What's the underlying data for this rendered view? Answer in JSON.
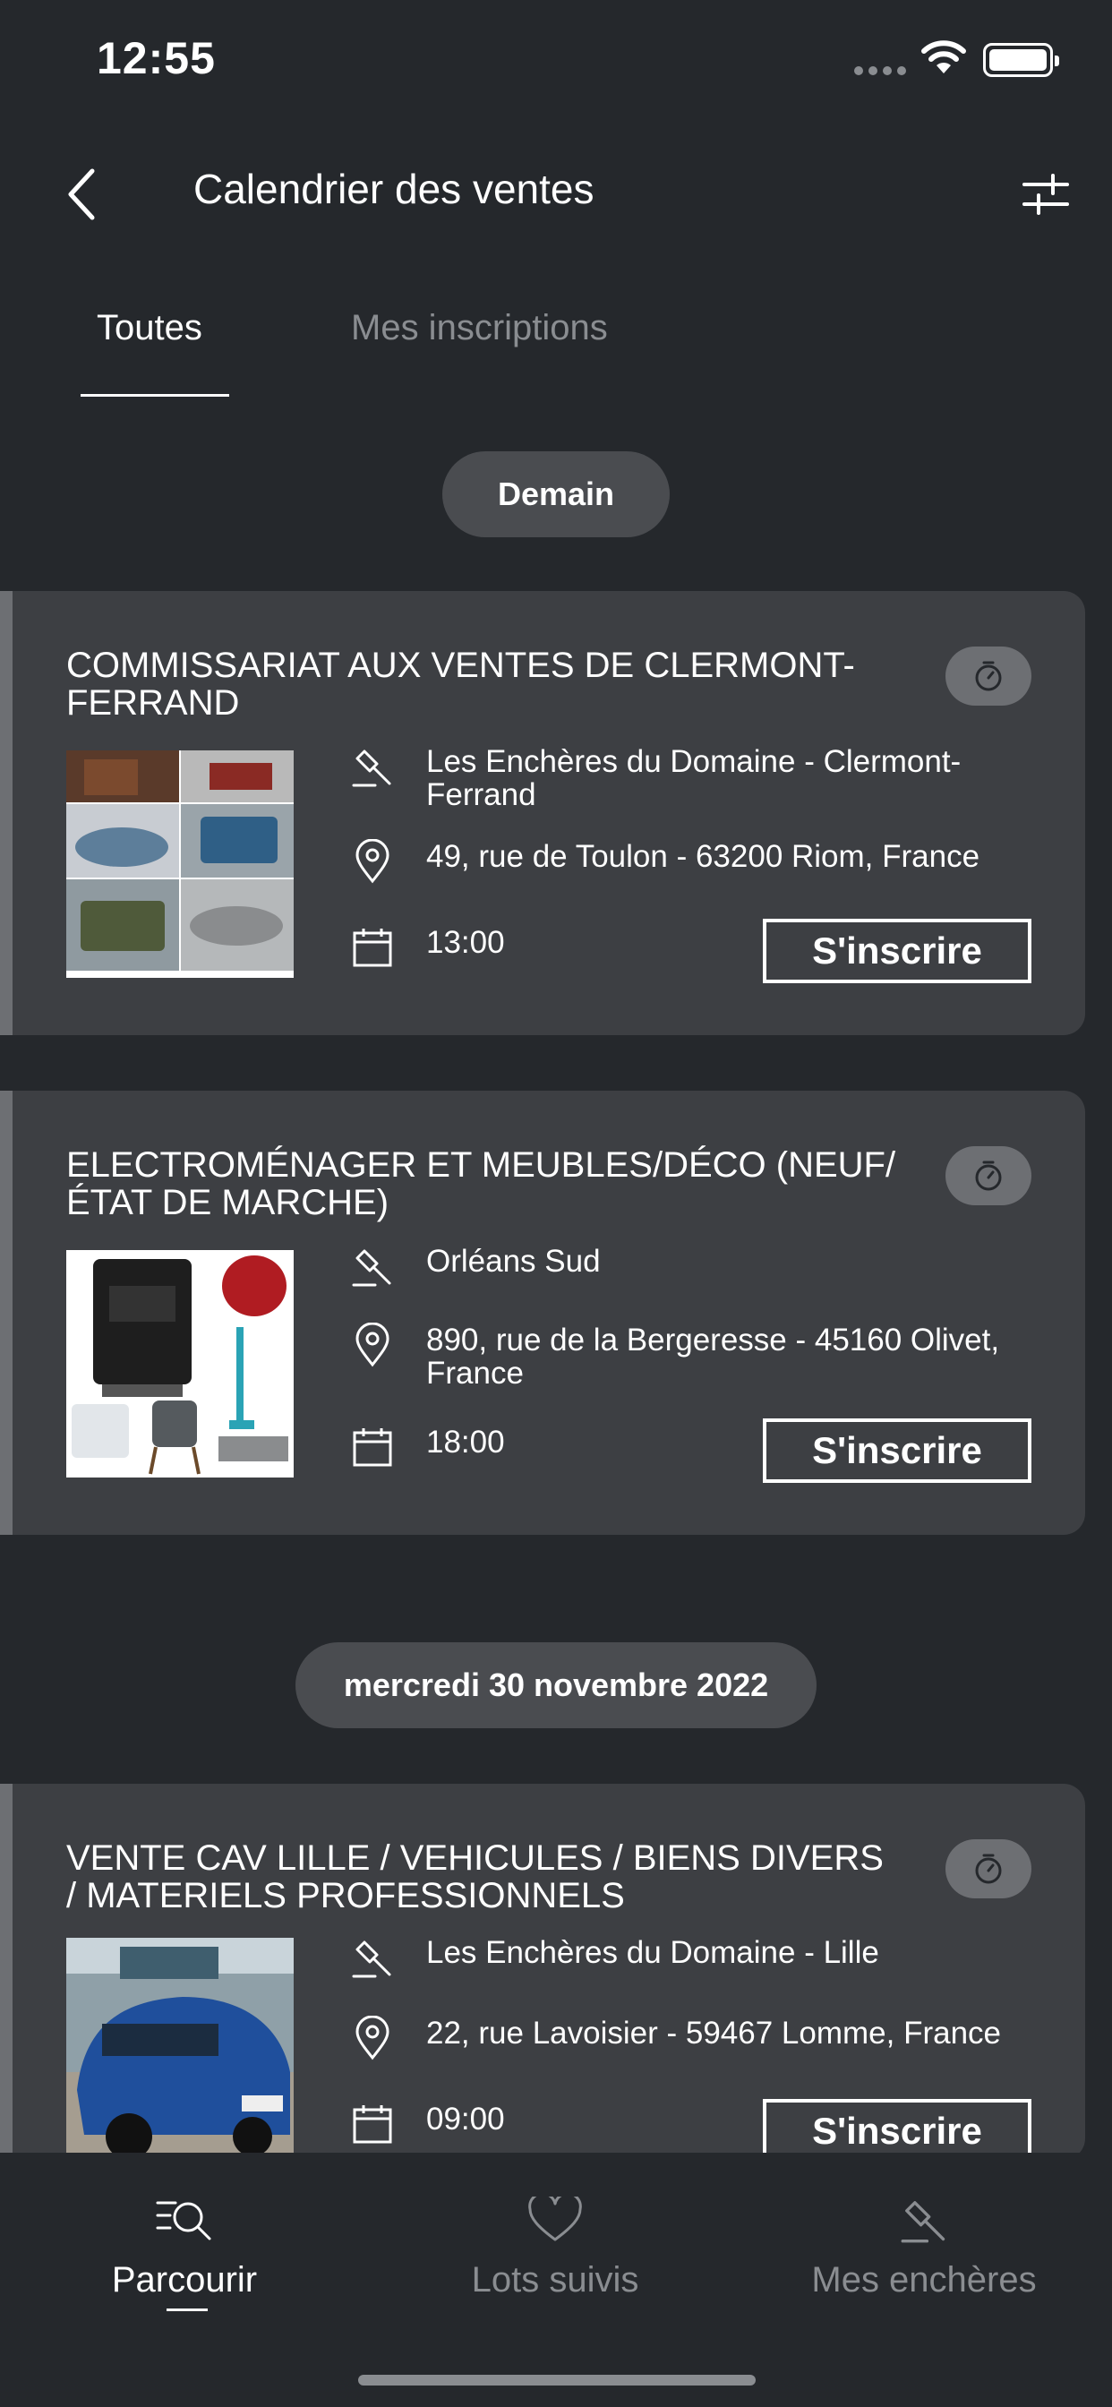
{
  "status": {
    "time": "12:55"
  },
  "header": {
    "title": "Calendrier des ventes"
  },
  "tabs": [
    {
      "label": "Toutes",
      "active": true
    },
    {
      "label": "Mes inscriptions",
      "active": false
    }
  ],
  "groups": [
    {
      "date_label": "Demain"
    },
    {
      "date_label": "mercredi 30 novembre 2022"
    }
  ],
  "sales": [
    {
      "title": "COMMISSARIAT AUX VENTES DE CLERMONT-FERRAND",
      "house": "Les Enchères du Domaine - Clermont-Ferrand",
      "address": "49, rue de Toulon  - 63200 Riom, France",
      "time": "13:00",
      "action": "S'inscrire",
      "image": "vehicles-collage"
    },
    {
      "title": "ELECTROMÉNAGER ET MEUBLES/DÉCO (NEUF/ ÉTAT DE MARCHE)",
      "house": "Orléans Sud",
      "address": "890, rue de la Bergeresse - 45160  Olivet, France",
      "time": "18:00",
      "action": "S'inscrire",
      "image": "appliances-collage"
    },
    {
      "title": "VENTE CAV LILLE / VEHICULES / BIENS DIVERS / MATERIELS PROFESSIONNELS",
      "house": "Les Enchères du Domaine - Lille",
      "address": "22, rue Lavoisier  - 59467 Lomme, France",
      "time": "09:00",
      "action": "S'inscrire",
      "image": "blue-car-photo"
    }
  ],
  "bottom_nav": [
    {
      "label": "Parcourir",
      "icon": "browse-search-icon",
      "active": true
    },
    {
      "label": "Lots suivis",
      "icon": "heart-icon",
      "active": false
    },
    {
      "label": "Mes enchères",
      "icon": "gavel-icon",
      "active": false
    }
  ],
  "colors": {
    "background": "#25282c",
    "card": "#3d3f43",
    "chip": "#4a4c50",
    "muted": "#8a8d91"
  }
}
